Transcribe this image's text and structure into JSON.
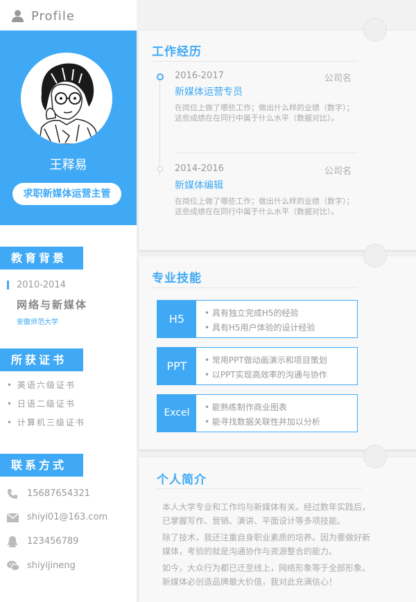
{
  "profile": {
    "label": "Profile",
    "name": "王释易",
    "objective": "求职新媒体运营主管"
  },
  "education": {
    "heading": "教育背景",
    "years": "2010-2014",
    "major": "网络与新媒体",
    "school": "安徽师范大学"
  },
  "certificates": {
    "heading": "所获证书",
    "items": [
      "• 英语六级证书",
      "• 日语二级证书",
      "• 计算机三级证书"
    ]
  },
  "contact": {
    "heading": "联系方式",
    "phone": "15687654321",
    "email": "shiyi01@163.com",
    "qq": "123456789",
    "wechat": "shiyijineng"
  },
  "experience": {
    "heading": "工作经历",
    "jobs": [
      {
        "years": "2016-2017",
        "company": "公司名",
        "title": "新媒体运营专员",
        "desc": "在岗位上做了哪些工作；做出什么样的业绩（数字）；这些成绩在在同行中属于什么水平（数据对比）。"
      },
      {
        "years": "2014-2016",
        "company": "公司名",
        "title": "新媒体编辑",
        "desc": "在岗位上做了哪些工作；做出什么样的业绩（数字）；这些成绩在在同行中属于什么水平（数据对比）。"
      }
    ]
  },
  "skills": {
    "heading": "专业技能",
    "items": [
      {
        "tag": "H5",
        "points": [
          "• 具有独立完成H5的经验",
          "• 具有H5用户体验的设计经验"
        ]
      },
      {
        "tag": "PPT",
        "points": [
          "• 常用PPT做动画演示和项目策划",
          "• 以PPT实现高效率的沟通与协作"
        ]
      },
      {
        "tag": "Excel",
        "points": [
          "• 能熟练制作商业图表",
          "• 能寻找数据关联性并加以分析"
        ]
      }
    ]
  },
  "bio": {
    "heading": "个人简介",
    "paragraphs": [
      "本人大学专业和工作均与新媒体有关。经过数年实践后，已掌握写作、营销、演讲、平面设计等多项技能。",
      "除了技术，我还注重自身职业素质的培养。因为要做好新媒体，考验的就是沟通协作与资源整合的能力。",
      "如今，大众行为都已迁至线上，网络形象等于全部形象。新媒体必创造品牌最大价值，我对此充满信心！"
    ]
  },
  "colors": {
    "accent": "#3fa9f5",
    "text": "#999999",
    "background": "#f2f2f2"
  }
}
